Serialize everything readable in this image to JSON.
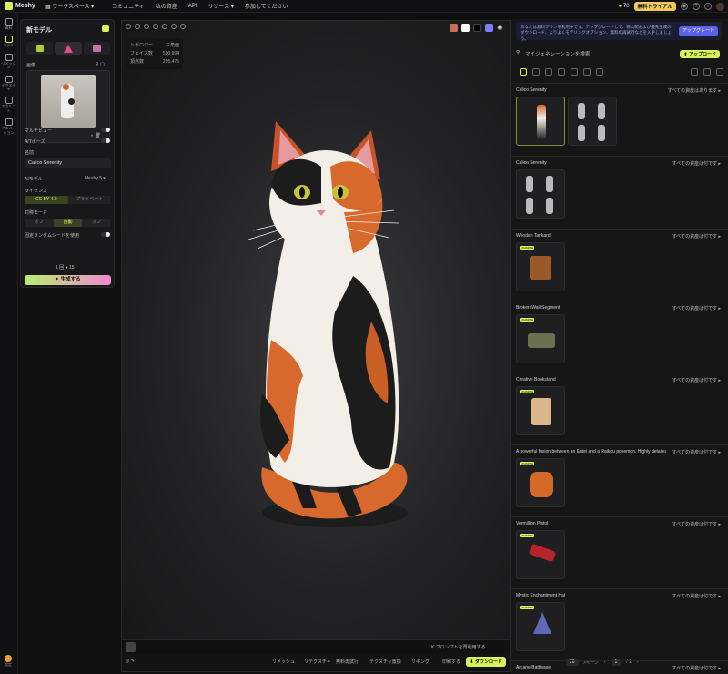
{
  "app": {
    "name": "Meshy"
  },
  "nav": {
    "workspace": "ワークスペース",
    "community": "コミュニティ",
    "assets": "私の資産",
    "api": "API",
    "resources": "リソース",
    "join": "参加してください"
  },
  "account": {
    "credits": "70",
    "trial": "無料トライアル",
    "notif_count": "3"
  },
  "rail": [
    {
      "label": "資料"
    },
    {
      "label": "モデル"
    },
    {
      "label": "リメッシュ"
    },
    {
      "label": "テクスチャ"
    },
    {
      "label": "スカルプト"
    },
    {
      "label": "アニメーション"
    }
  ],
  "rail_bottom": {
    "label": "設定"
  },
  "panel": {
    "title": "新モデル",
    "image_label": "画像",
    "multiview_label": "マルチビュー",
    "apose_label": "A/Tポーズ",
    "name_label": "名前",
    "name_value": "Calico Serenity",
    "ai_model_label": "AIモデル",
    "ai_model_value": "Meshy 5",
    "license_label": "ライセンス",
    "license_options": [
      "CC BY 4.0",
      "プライベート"
    ],
    "symmetry_label": "対称モード",
    "symmetry_options": [
      "オフ",
      "自動",
      "オン"
    ],
    "seed_label": "固定ランダムシードを使用",
    "cost": "1 回",
    "cost_credits": "15",
    "generate": "生成する"
  },
  "viewport": {
    "stats": [
      {
        "k": "トポロジー",
        "v": "三角面"
      },
      {
        "k": "フェイス数",
        "v": "590,994"
      },
      {
        "k": "頂点数",
        "v": "295,475"
      }
    ],
    "prompt_hint": "K プロンプトを再利用する",
    "bottom_buttons": [
      "リメッシュ",
      "リテクスチャ",
      "無料再試行",
      "テクスチャ置換",
      "リギング",
      "印刷する"
    ],
    "download": "ダウンロード",
    "colors": {
      "swatch1": "#ffffff",
      "swatch2": "#000000",
      "swatch3": "#7c7cff"
    }
  },
  "right": {
    "banner": "あなたは無料プランを利用中です。アップグレードして、非公開および優先生成のダウンロード、よりよくモデリングオプション、無料の再試行などを入手しましょう。",
    "upgrade": "アップグレード",
    "search_placeholder": "マイジェネレーションを検索",
    "upload": "アップロード",
    "items": [
      {
        "title": "Calico Serenity",
        "link": "すべての資産はあります ▸"
      },
      {
        "title": "Calico Serenity",
        "link": "すべての資産は付です ▸"
      },
      {
        "title": "Wooden Tankard",
        "link": "すべての資産は付です ▸"
      },
      {
        "title": "Broken Wall Segment",
        "link": "すべての資産は付です ▸"
      },
      {
        "title": "Creative Bookstand",
        "link": "すべての資産は付です ▸"
      },
      {
        "title": "A powerful fusion between an Entei and a Raikou pokemon. Highly detailed,...",
        "link": "すべての資産は付です ▸"
      },
      {
        "title": "Vermillion Pistol",
        "link": "すべての資産は付です ▸"
      },
      {
        "title": "Mystic Enchantment Hat",
        "link": "すべての資産は付です ▸"
      },
      {
        "title": "Arcane Battleaxe",
        "link": "すべての資産は付です ▸"
      }
    ],
    "example_badge": "EXAMPLE",
    "pager": {
      "per_page": "20",
      "per_page_label": "/ページ",
      "page": "1",
      "total": "/ 1"
    }
  }
}
